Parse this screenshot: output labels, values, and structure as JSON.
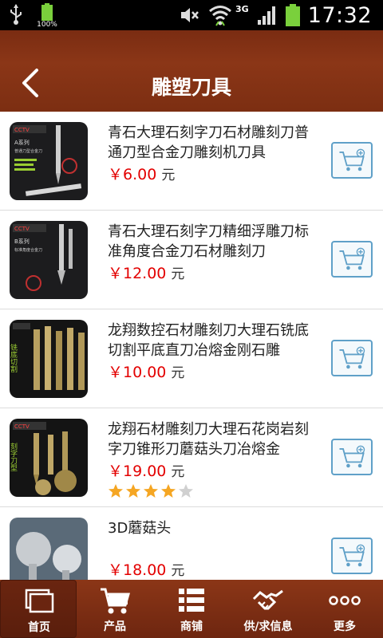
{
  "status_bar": {
    "battery_percent": "100%",
    "network": "3G",
    "time": "17:32",
    "icons": [
      "usb-icon",
      "battery-small-icon",
      "mute-icon",
      "wifi-icon",
      "signal-icon",
      "battery-icon"
    ]
  },
  "header": {
    "title": "雕塑刀具",
    "back_icon": "back-arrow-icon",
    "background": "#7f2f13"
  },
  "products": [
    {
      "name": "青石大理石刻字刀石材雕刻刀普通刀型合金刀雕刻机刀具",
      "price": "￥6.00",
      "unit": "元",
      "thumb_caption": "A系列",
      "thumb_subtitle": "普通刀型合金刀",
      "rating": null
    },
    {
      "name": "青石大理石刻字刀精细浮雕刀标准角度合金刀石材雕刻刀",
      "price": "￥12.00",
      "unit": "元",
      "thumb_caption": "B系列",
      "thumb_subtitle": "标准角度合金刀",
      "rating": null
    },
    {
      "name": "龙翔数控石材雕刻刀大理石铣底切割平底直刀冶熔金刚石雕",
      "price": "￥10.00",
      "unit": "元",
      "thumb_caption": "铣底切割",
      "thumb_subtitle": "",
      "rating": null
    },
    {
      "name": "龙翔石材雕刻刀大理石花岗岩刻字刀锥形刀蘑菇头刀冶熔金",
      "price": "￥19.00",
      "unit": "元",
      "thumb_caption": "刻字刀型",
      "thumb_subtitle": "",
      "rating": 4
    },
    {
      "name": "3D蘑菇头",
      "price": "￥18.00",
      "unit": "元",
      "thumb_caption": "",
      "thumb_subtitle": "",
      "rating": null
    }
  ],
  "bottom_nav": [
    {
      "label": "首页",
      "icon": "home-icon",
      "active": true
    },
    {
      "label": "产品",
      "icon": "cart-icon",
      "active": false
    },
    {
      "label": "商铺",
      "icon": "list-icon",
      "active": false
    },
    {
      "label": "供/求信息",
      "icon": "handshake-icon",
      "active": false
    },
    {
      "label": "更多",
      "icon": "more-icon",
      "active": false
    }
  ],
  "colors": {
    "brand": "#7f2f13",
    "price": "#e30000",
    "cart_border": "#5fa0c8",
    "star": "#f5a623"
  }
}
